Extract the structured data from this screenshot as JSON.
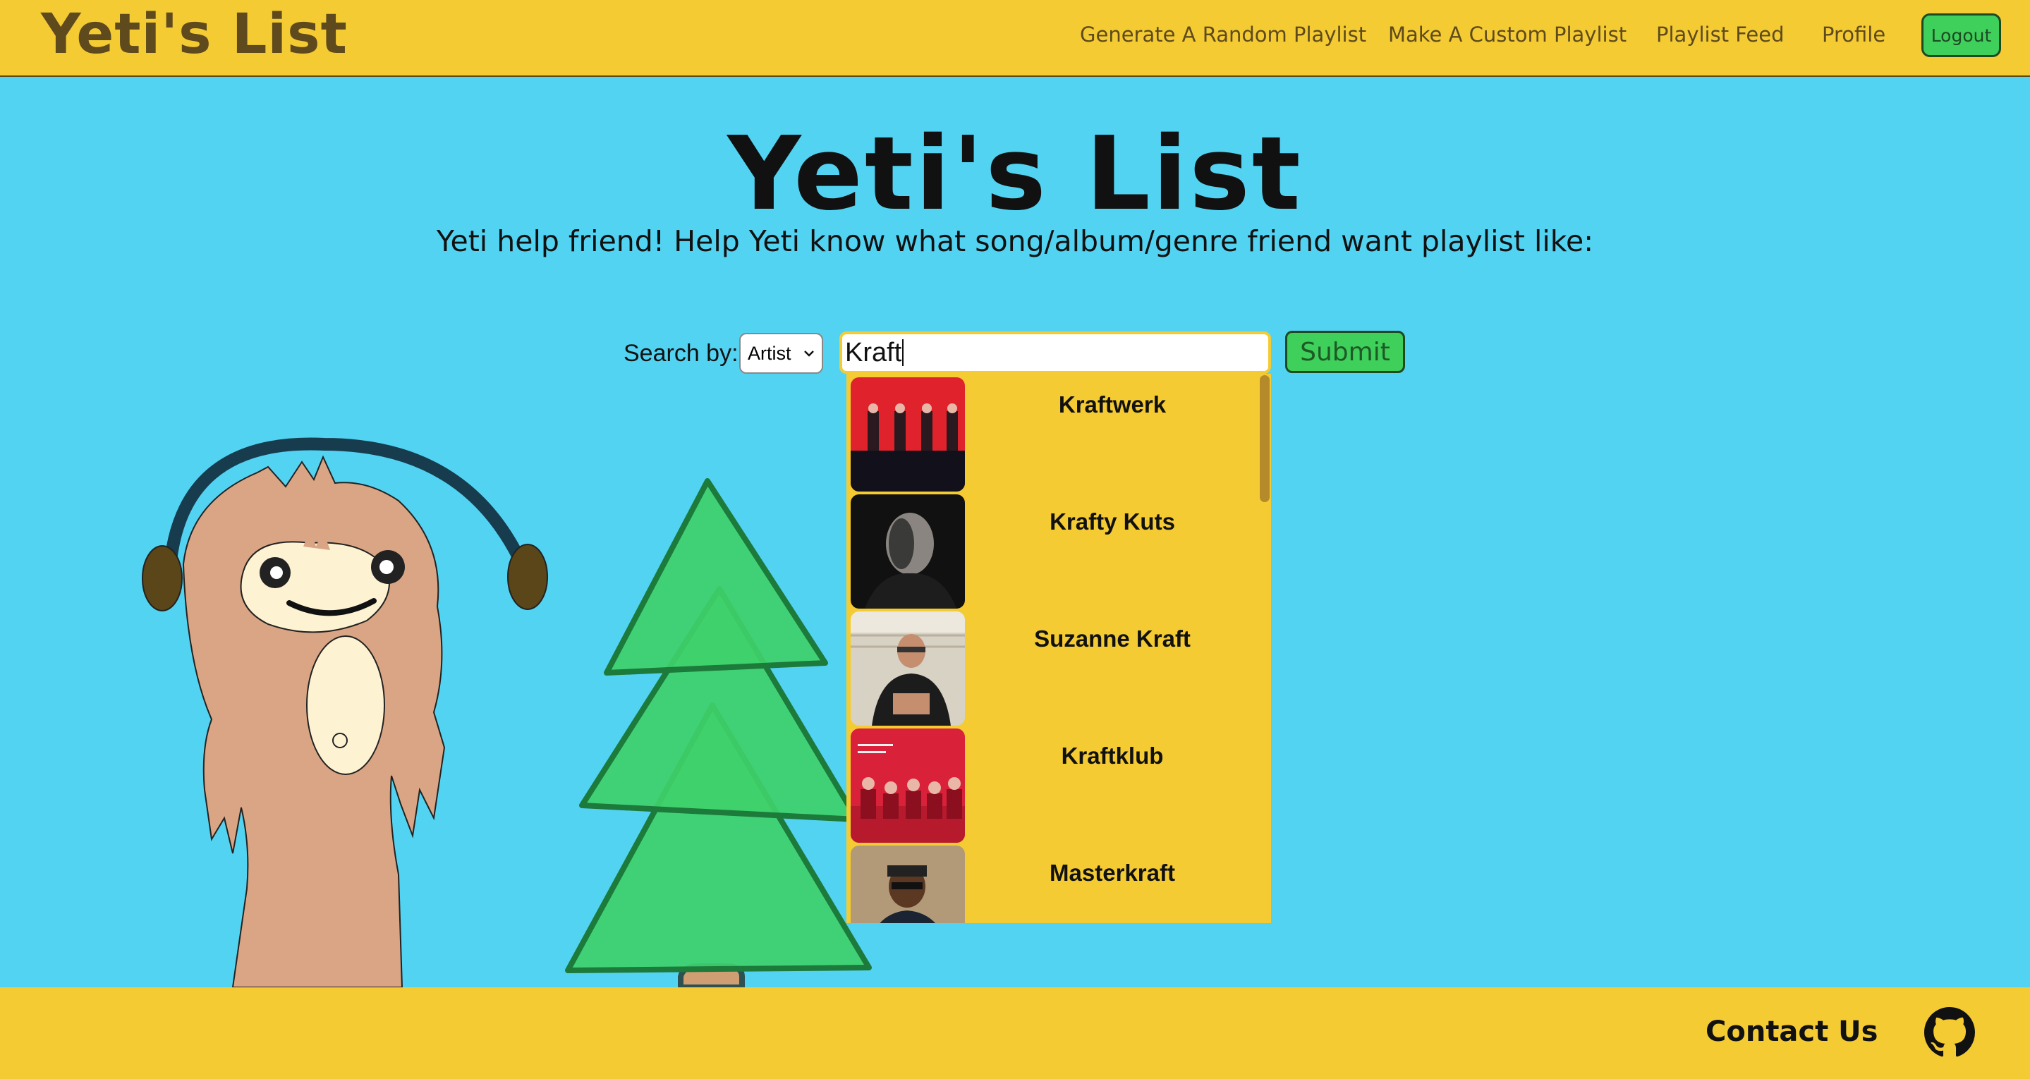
{
  "navbar": {
    "brand": "Yeti's List",
    "links": [
      "Generate A Random Playlist",
      "Make A Custom Playlist",
      "Playlist Feed",
      "Profile"
    ],
    "logout_label": "Logout"
  },
  "hero": {
    "title": "Yeti's List",
    "subtitle": "Yeti help friend! Help Yeti know what song/album/genre friend want playlist like:"
  },
  "search": {
    "label": "Search by:",
    "type_selected": "Artist",
    "query": "Kraft",
    "submit_label": "Submit"
  },
  "results": [
    {
      "name": "Kraftwerk"
    },
    {
      "name": "Krafty Kuts"
    },
    {
      "name": "Suzanne Kraft"
    },
    {
      "name": "Kraftklub"
    },
    {
      "name": "Masterkraft"
    }
  ],
  "footer": {
    "contact_label": "Contact Us"
  },
  "colors": {
    "background": "#53d3f2",
    "header": "#f4cb33",
    "accent_green": "#3fcf5b",
    "brand_brown": "#5e4a1d"
  },
  "icons": {
    "footer_icon": "github-icon",
    "select_chevron": "chevron-down-icon"
  }
}
